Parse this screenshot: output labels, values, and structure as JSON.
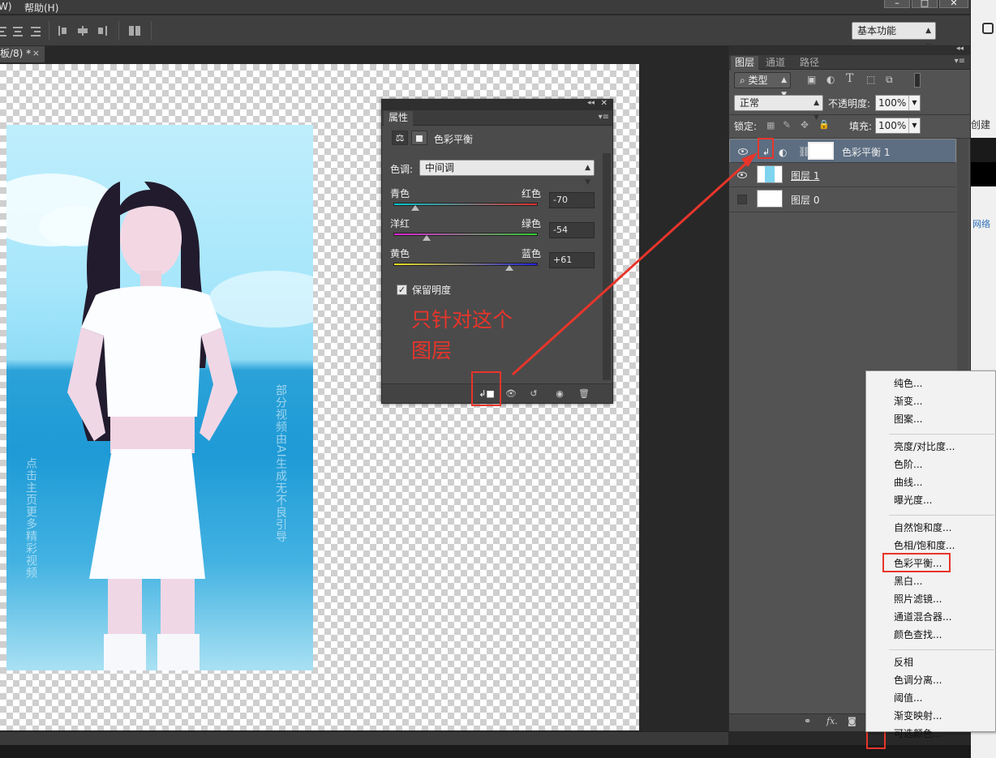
{
  "menubar": {
    "items": [
      "W)",
      "帮助(H)"
    ],
    "window_buttons": [
      "–",
      "□",
      "✕"
    ]
  },
  "options_bar": {
    "workspace": "基本功能"
  },
  "document": {
    "tab_label": "板/8) *",
    "tab_close": "×"
  },
  "photo": {
    "watermark_left": "点击主页更多精彩视频",
    "watermark_right": "部分视频由AI生成无不良引导"
  },
  "properties_panel": {
    "tab": "属性",
    "title": "色彩平衡",
    "tone_label": "色调:",
    "tone_value": "中间调",
    "sliders": [
      {
        "left": "青色",
        "right": "红色",
        "value": "-70",
        "level": -70
      },
      {
        "left": "洋红",
        "right": "绿色",
        "value": "-54",
        "level": -54
      },
      {
        "left": "黄色",
        "right": "蓝色",
        "value": "+61",
        "level": 61
      }
    ],
    "preserve_label": "保留明度",
    "preserve_checked": true,
    "annotation": [
      "只针对这个",
      "图层"
    ]
  },
  "layers_panel": {
    "tabs": [
      "图层",
      "通道",
      "路径"
    ],
    "filter": "类型",
    "blend_mode": "正常",
    "opacity_label": "不透明度:",
    "opacity": "100%",
    "lock_label": "锁定:",
    "fill_label": "填充:",
    "fill": "100%",
    "layers": [
      {
        "name": "色彩平衡 1",
        "visible": true,
        "selected": true
      },
      {
        "name": "图层 1",
        "visible": true,
        "selected": false
      },
      {
        "name": "图层 0",
        "visible": false,
        "selected": false
      }
    ],
    "footer_fx": "fx."
  },
  "adjustment_menu": {
    "groups": [
      [
        "纯色...",
        "渐变...",
        "图案..."
      ],
      [
        "亮度/对比度...",
        "色阶...",
        "曲线...",
        "曝光度..."
      ],
      [
        "自然饱和度...",
        "色相/饱和度...",
        "色彩平衡...",
        "黑白...",
        "照片滤镜...",
        "通道混合器...",
        "颜色查找..."
      ],
      [
        "反相",
        "色调分离...",
        "阈值...",
        "渐变映射...",
        "可选颜色..."
      ]
    ],
    "highlighted": "色彩平衡..."
  },
  "right_strip": {
    "text1": "创建",
    "text2": "网络"
  },
  "colors": {
    "annotation_red": "#e8352b",
    "panel_bg": "#535353",
    "selected_layer": "#5d6e82"
  }
}
